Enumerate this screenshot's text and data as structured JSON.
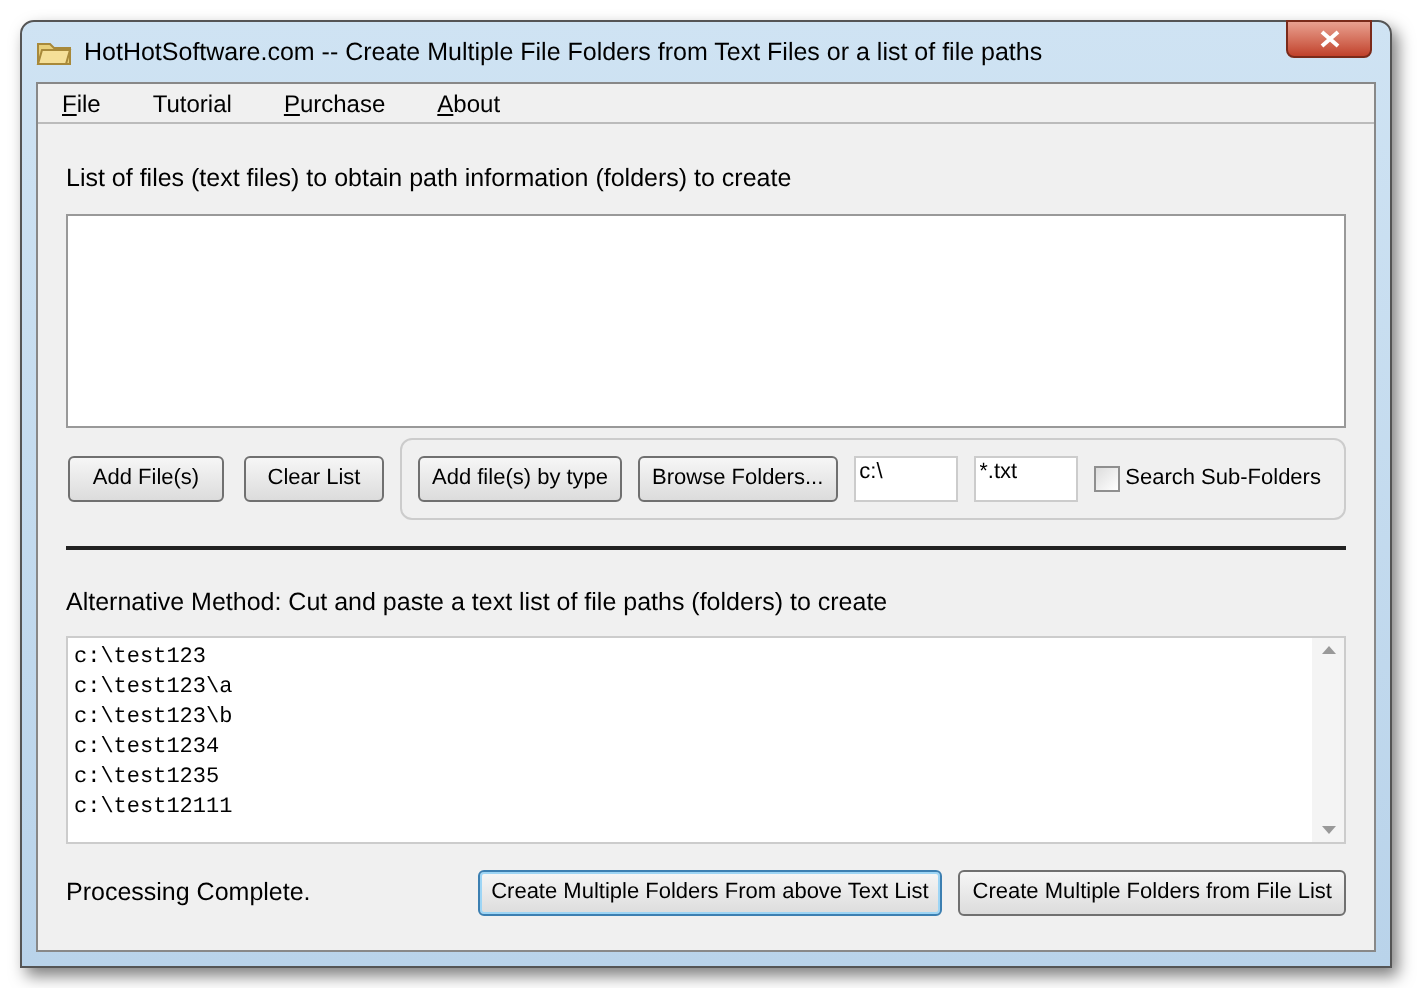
{
  "window": {
    "title": "HotHotSoftware.com -- Create Multiple File Folders from Text Files or a list of file paths"
  },
  "menu": [
    {
      "label": "File",
      "underlined": true
    },
    {
      "label": "Tutorial",
      "underlined": false
    },
    {
      "label": "Purchase",
      "underlined": true
    },
    {
      "label": "About",
      "underlined": true
    }
  ],
  "file_list": {
    "label": "List of files (text files) to obtain path information (folders) to create"
  },
  "buttons": [
    "Add File(s)",
    "Clear List"
  ],
  "type_group": {
    "button": "Add file(s) by type",
    "browse_button": "Browse Folders...",
    "folder": "c:\\",
    "pattern": "*.txt",
    "checkbox": {
      "label": "Search Sub-Folders",
      "checked": false
    }
  },
  "alternative": {
    "label": "Alternative Method: Cut and paste a text list of file paths (folders) to create",
    "lines": [
      "c:\\test123",
      "c:\\test123\\a",
      "c:\\test123\\b",
      "c:\\test1234",
      "c:\\test1235",
      "c:\\test12111"
    ]
  },
  "status": "Processing Complete.",
  "actions": [
    {
      "label": "Create Multiple Folders From above Text List",
      "selected": true
    },
    {
      "label": "Create Multiple Folders from File List",
      "selected": false
    }
  ]
}
